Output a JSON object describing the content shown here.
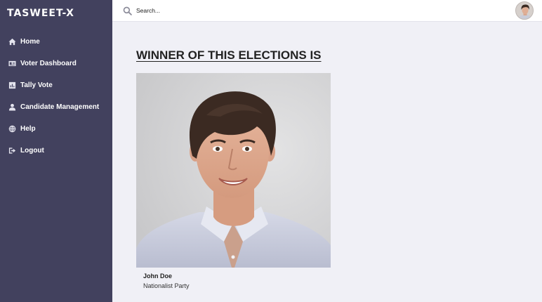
{
  "brand": {
    "name": "TASWEET-X"
  },
  "sidebar": {
    "items": [
      {
        "label": "Home",
        "icon": "home-icon"
      },
      {
        "label": "Voter Dashboard",
        "icon": "id-card-icon"
      },
      {
        "label": "Tally Vote",
        "icon": "bar-chart-icon"
      },
      {
        "label": "Candidate Management",
        "icon": "user-icon"
      },
      {
        "label": "Help",
        "icon": "globe-icon"
      },
      {
        "label": "Logout",
        "icon": "logout-icon"
      }
    ]
  },
  "topbar": {
    "search_placeholder": "Search...",
    "search_icon": "search-icon",
    "avatar_icon": "user-avatar"
  },
  "main": {
    "heading": "WINNER OF THIS ELECTIONS IS",
    "winner": {
      "name": "John Doe",
      "party": "Nationalist Party"
    }
  },
  "colors": {
    "sidebar_bg": "#42415e",
    "content_bg": "#f0f0f6",
    "topbar_bg": "#ffffff"
  }
}
